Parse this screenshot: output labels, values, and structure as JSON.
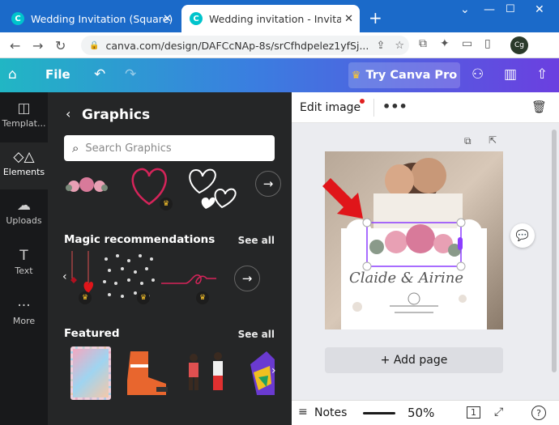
{
  "browser": {
    "tabs": [
      {
        "label": "Wedding Invitation (Square)",
        "active": false
      },
      {
        "label": "Wedding invitation - Invitation (",
        "active": true
      }
    ],
    "url": "canva.com/design/DAFCcNAp-8s/srCfhdpelez1yfSj...",
    "profile_initials": "Cg"
  },
  "toolbar": {
    "file_label": "File",
    "try_pro_label": "Try Canva Pro"
  },
  "rail": {
    "items": [
      {
        "label": "Templat...",
        "icon": "template-icon"
      },
      {
        "label": "Elements",
        "icon": "elements-icon",
        "active": true
      },
      {
        "label": "Uploads",
        "icon": "upload-icon"
      },
      {
        "label": "Text",
        "icon": "text-icon"
      },
      {
        "label": "More",
        "icon": "more-icon"
      }
    ]
  },
  "panel": {
    "title": "Graphics",
    "search_placeholder": "Search Graphics",
    "sections": [
      {
        "title": "Magic recommendations",
        "see_all": "See all"
      },
      {
        "title": "Featured",
        "see_all": "See all"
      }
    ]
  },
  "editor": {
    "edit_image_label": "Edit image",
    "add_page_label": "+ Add page",
    "design_text": {
      "names": "Claide & Airine",
      "ampersand": "&"
    },
    "accent_color": "#8b3dff",
    "arrow_color": "#e0151a"
  },
  "bottom": {
    "notes_label": "Notes",
    "zoom": "50%",
    "page_count": "1"
  }
}
